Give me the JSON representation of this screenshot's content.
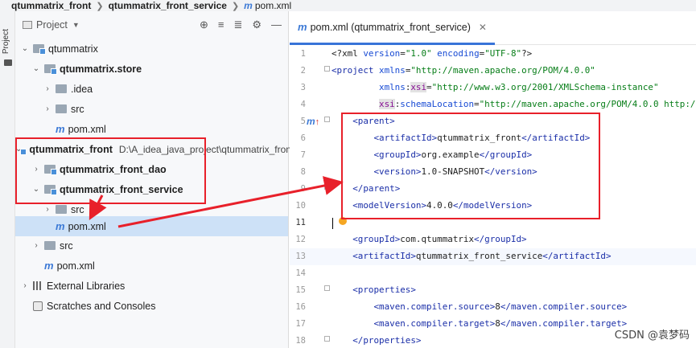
{
  "breadcrumb": {
    "items": [
      "qtummatrix_front",
      "qtummatrix_front_service",
      "pom.xml"
    ]
  },
  "tool_strip": {
    "label": "Project"
  },
  "project_panel": {
    "title": "Project",
    "toolbar_icons": [
      "crosshair-icon",
      "collapse-all-icon",
      "expand-all-icon",
      "gear-icon",
      "minimize-icon"
    ],
    "tree": [
      {
        "label": "qtummatrix",
        "arrow": "expanded",
        "icon": "module-folder",
        "bold": false,
        "path": ""
      },
      {
        "label": "qtummatrix.store",
        "arrow": "expanded",
        "icon": "module-folder",
        "bold": true,
        "path": ""
      },
      {
        "label": ".idea",
        "arrow": "collapsed",
        "icon": "folder",
        "bold": false,
        "path": ""
      },
      {
        "label": "src",
        "arrow": "collapsed",
        "icon": "folder",
        "bold": false,
        "path": ""
      },
      {
        "label": "pom.xml",
        "arrow": "none",
        "icon": "maven",
        "bold": false,
        "path": ""
      },
      {
        "label": "qtummatrix_front",
        "arrow": "expanded",
        "icon": "module-folder",
        "bold": true,
        "path": "D:\\A_idea_java_project\\qtummatrix_fron"
      },
      {
        "label": "qtummatrix_front_dao",
        "arrow": "collapsed",
        "icon": "module-folder",
        "bold": true,
        "path": ""
      },
      {
        "label": "qtummatrix_front_service",
        "arrow": "expanded",
        "icon": "module-folder",
        "bold": true,
        "path": ""
      },
      {
        "label": "src",
        "arrow": "collapsed",
        "icon": "folder",
        "bold": false,
        "path": ""
      },
      {
        "label": "pom.xml",
        "arrow": "none",
        "icon": "maven",
        "bold": false,
        "path": "",
        "selected": true
      },
      {
        "label": "src",
        "arrow": "collapsed",
        "icon": "folder",
        "bold": false,
        "path": ""
      },
      {
        "label": "pom.xml",
        "arrow": "none",
        "icon": "maven",
        "bold": false,
        "path": ""
      },
      {
        "label": "External Libraries",
        "arrow": "collapsed",
        "icon": "library",
        "bold": false,
        "path": ""
      },
      {
        "label": "Scratches and Consoles",
        "arrow": "none",
        "icon": "scratches",
        "bold": false,
        "path": ""
      }
    ]
  },
  "editor": {
    "tab_label": "pom.xml (qtummatrix_front_service)",
    "line_numbers": [
      "1",
      "2",
      "3",
      "4",
      "5",
      "6",
      "7",
      "8",
      "9",
      "10",
      "11",
      "12",
      "13",
      "14",
      "15",
      "16",
      "17",
      "18"
    ],
    "current_line": "11",
    "gutter_marker": "m"
  },
  "watermark": "CSDN @袁梦码",
  "colors": {
    "annotation_red": "#e8202a",
    "accent_blue": "#3874d8",
    "selection": "#cde1f7"
  }
}
